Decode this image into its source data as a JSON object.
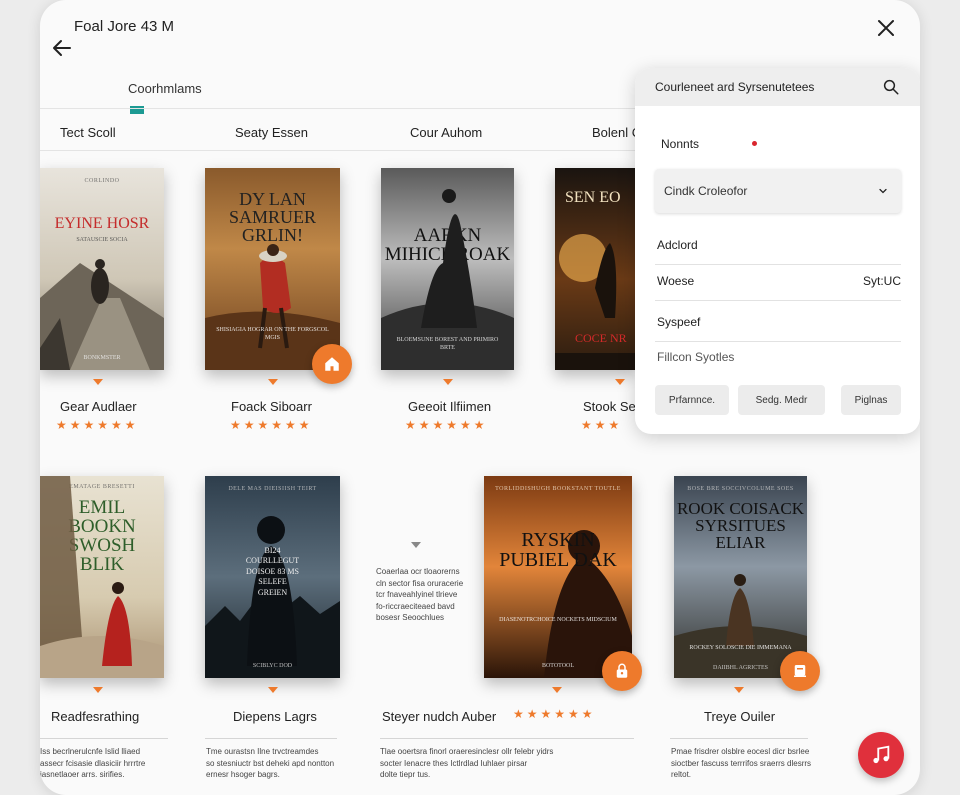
{
  "status": {
    "time": "Foal Jore 43 M"
  },
  "nav": {
    "section_tab": "Coorhmlams"
  },
  "columns": [
    "Tect Scoll",
    "Seaty Essen",
    "Cour Auhom",
    "Bolenl C"
  ],
  "row1": [
    {
      "cover_top": "CORLINDO",
      "cover_title": "EYINE HOSR",
      "cover_sub": "SATAUSCIE SOCIA",
      "cover_bottom": "BONKMSTER",
      "title": "Gear Audlaer",
      "stars": "★★★★★★"
    },
    {
      "cover_title": "DY LAN SAMRUER GRLIN!",
      "cover_sub": "SHISIAGIA HOGRAR ON THE FORGSCOL MGIS",
      "title": "Foack Siboarr",
      "stars": "★★★★★★"
    },
    {
      "cover_title": "AARKN MIHICL ROAK",
      "cover_sub": "BLOEMSUNE BOREST AND PRIMIRO BRTE",
      "title": "Geeoit Ilfiimen",
      "stars": "★★★★★★"
    },
    {
      "cover_title": "SEN EO",
      "cover_red": "COCE NR",
      "title": "Stook Se",
      "stars": "★★★"
    }
  ],
  "row2": [
    {
      "cover_top": "EMATAGE BRESETTI",
      "cover_title": "EMIL BOOKN SWOSH BLIK",
      "title": "Readfesrathing",
      "desc": [
        "Iss becrlnerulcnfe Islid lliaed",
        "assecr fcisasie dlasiciir hrrrtre",
        "iasnetlaoer arrs. sirifies."
      ]
    },
    {
      "cover_top": "DELE MAS DIEISIISH TEIRT",
      "cover_title": "BI24 COURLLEGUT DOISOE 83 MS SELEFE GREIEN",
      "cover_bottom": "SCIBLYC DOD",
      "title": "Diepens Lagrs",
      "desc": [
        "Tme ourastsn Ilne trvctreamdes",
        "so stesniuctr bst deheki apd nontton",
        "ernesr hsoger bagrs."
      ]
    },
    {
      "cover_top": "TORLIDDISHUGH BOOKSTANT TOUTLE",
      "cover_title": "RYSKIN PUBIEL DAK",
      "cover_sub": "DIASENOTRCHOICE NOCKETS MIDSCIUM",
      "cover_bottom": "BOTOTOOL",
      "title": "Steyer nudch Auber",
      "stars": "★★★★★★",
      "desc": [
        "Tlae ooertsra finorl oraeresinclesr ollr felebr yidrs",
        "socter Ienacre thes Ictlrdlad Iuhlaer pirsar",
        "dolte tiepr tus."
      ]
    },
    {
      "cover_top": "BOSE BRE SOCCIVCOLUME SOES",
      "cover_title": "ROOK COISACK SYRSITUES ELIAR",
      "cover_sub": "ROCKEY SOLOSCIE DIE IMMEMANA",
      "cover_bottom": "DAIIBHL AGRICTES",
      "title": "Treye Ouiler",
      "desc": [
        "Pmae frisdrer olsblre eocesl dicr bsrlee",
        "sioctber fascuss terrrifos sraerrs dlesrrs",
        "reltot."
      ]
    }
  ],
  "aside_note": [
    "Coaerlaa ocr tloaorerns",
    "cln sector fisa oruracerie",
    "tcr fnaveahlyinel tlrieve",
    "fo-riccraeciteaed bavd",
    "bosesr Seoochlues"
  ],
  "panel": {
    "title": "Courleneet ard Syrsenutetees",
    "name_label": "Nonnts",
    "select_value": "Cindk Croleofor",
    "added_label": "Adclord",
    "woese_label": "Woese",
    "woese_value": "Syt:UC",
    "syspref_label": "Syspeef",
    "filter_label": "Fillcon Syotles",
    "chips": [
      "Prfarnnce.",
      "Sedg. Medr",
      "Piglnas"
    ]
  },
  "colors": {
    "accent": "#ee7a2c",
    "teal": "#1c9a93",
    "music": "#e0303c"
  }
}
